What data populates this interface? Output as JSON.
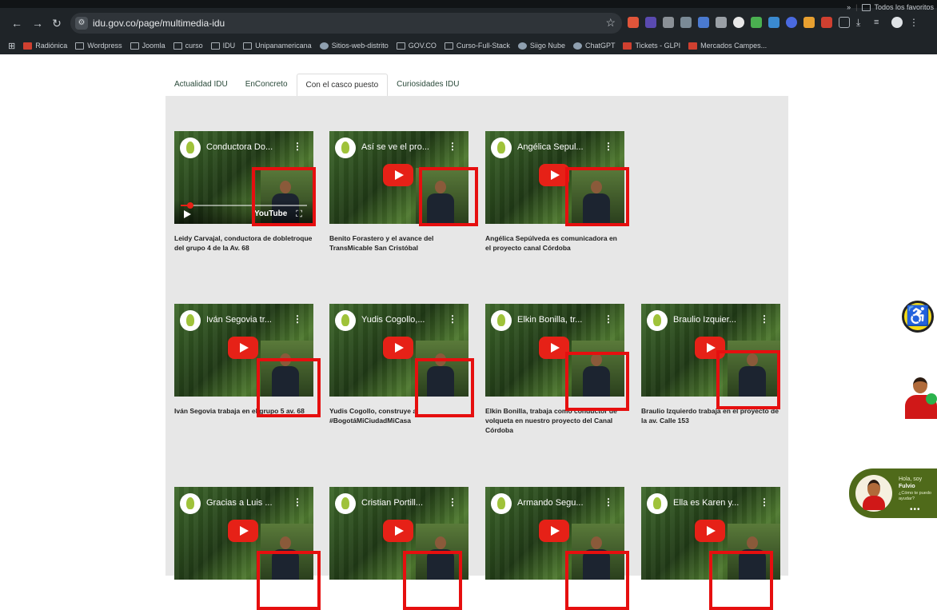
{
  "browser": {
    "url": "idu.gov.co/page/multimedia-idu",
    "bookmarks": [
      {
        "label": "Radiónica",
        "icon": "radionica-icon"
      },
      {
        "label": "Wordpress",
        "icon": "folder-icon"
      },
      {
        "label": "Joomla",
        "icon": "folder-icon"
      },
      {
        "label": "curso",
        "icon": "folder-icon"
      },
      {
        "label": "IDU",
        "icon": "folder-icon"
      },
      {
        "label": "Unipanamericana",
        "icon": "folder-icon"
      },
      {
        "label": "Sitios-web-distrito",
        "icon": "globe-icon"
      },
      {
        "label": "GOV.CO",
        "icon": "folder-icon"
      },
      {
        "label": "Curso-Full-Stack",
        "icon": "folder-icon"
      },
      {
        "label": "Siigo Nube",
        "icon": "cloud-icon"
      },
      {
        "label": "ChatGPT",
        "icon": "chatgpt-icon"
      },
      {
        "label": "Tickets - GLPI",
        "icon": "glpi-icon"
      },
      {
        "label": "Mercados Campes...",
        "icon": "market-icon"
      }
    ],
    "more_bookmarks": "»",
    "all_bookmarks": "Todos los favoritos"
  },
  "tabs": [
    {
      "label": "Actualidad IDU",
      "active": false
    },
    {
      "label": "EnConcreto",
      "active": false
    },
    {
      "label": "Con el casco puesto",
      "active": true
    },
    {
      "label": "Curiosidades IDU",
      "active": false
    }
  ],
  "videos": [
    {
      "title": "Conductora Do...",
      "caption": "Leidy Carvajal, conductora de dobletroque del grupo 4 de la Av. 68",
      "playing": true,
      "youtube_label": "YouTube"
    },
    {
      "title": "Así se ve el pro...",
      "caption": "Benito Forastero y el avance del TransMicable San Cristóbal"
    },
    {
      "title": "Angélica Sepul...",
      "caption": "Angélica Sepúlveda es comunicadora en el proyecto canal Córdoba"
    },
    {
      "title": "Iván Segovia tr...",
      "caption": "Iván Segovia trabaja en el grupo 5 av. 68"
    },
    {
      "title": "Yudis Cogollo,...",
      "caption": "Yudis Cogollo, construye a #BogotáMiCiudadMiCasa"
    },
    {
      "title": "Elkin Bonilla, tr...",
      "caption": "Elkin Bonilla, trabaja como conductor de volqueta en nuestro proyecto del Canal Córdoba"
    },
    {
      "title": "Braulio Izquier...",
      "caption": "Braulio Izquierdo trabaja en el proyecto de la av. Calle 153"
    },
    {
      "title": "Gracias a Luis ...",
      "caption": ""
    },
    {
      "title": "Cristian Portill...",
      "caption": ""
    },
    {
      "title": "Armando Segu...",
      "caption": ""
    },
    {
      "title": "Ella es Karen y...",
      "caption": ""
    }
  ],
  "chat": {
    "greeting": "Hola, soy",
    "name": "Fulvio",
    "prompt": "¿Cómo te puedo ayudar?",
    "dots": "•••"
  },
  "colors": {
    "highlight_red": "#e60f0f",
    "youtube_red": "#e62117",
    "accessibility_yellow": "#f7dc16",
    "chat_green": "#4f6a1a"
  }
}
